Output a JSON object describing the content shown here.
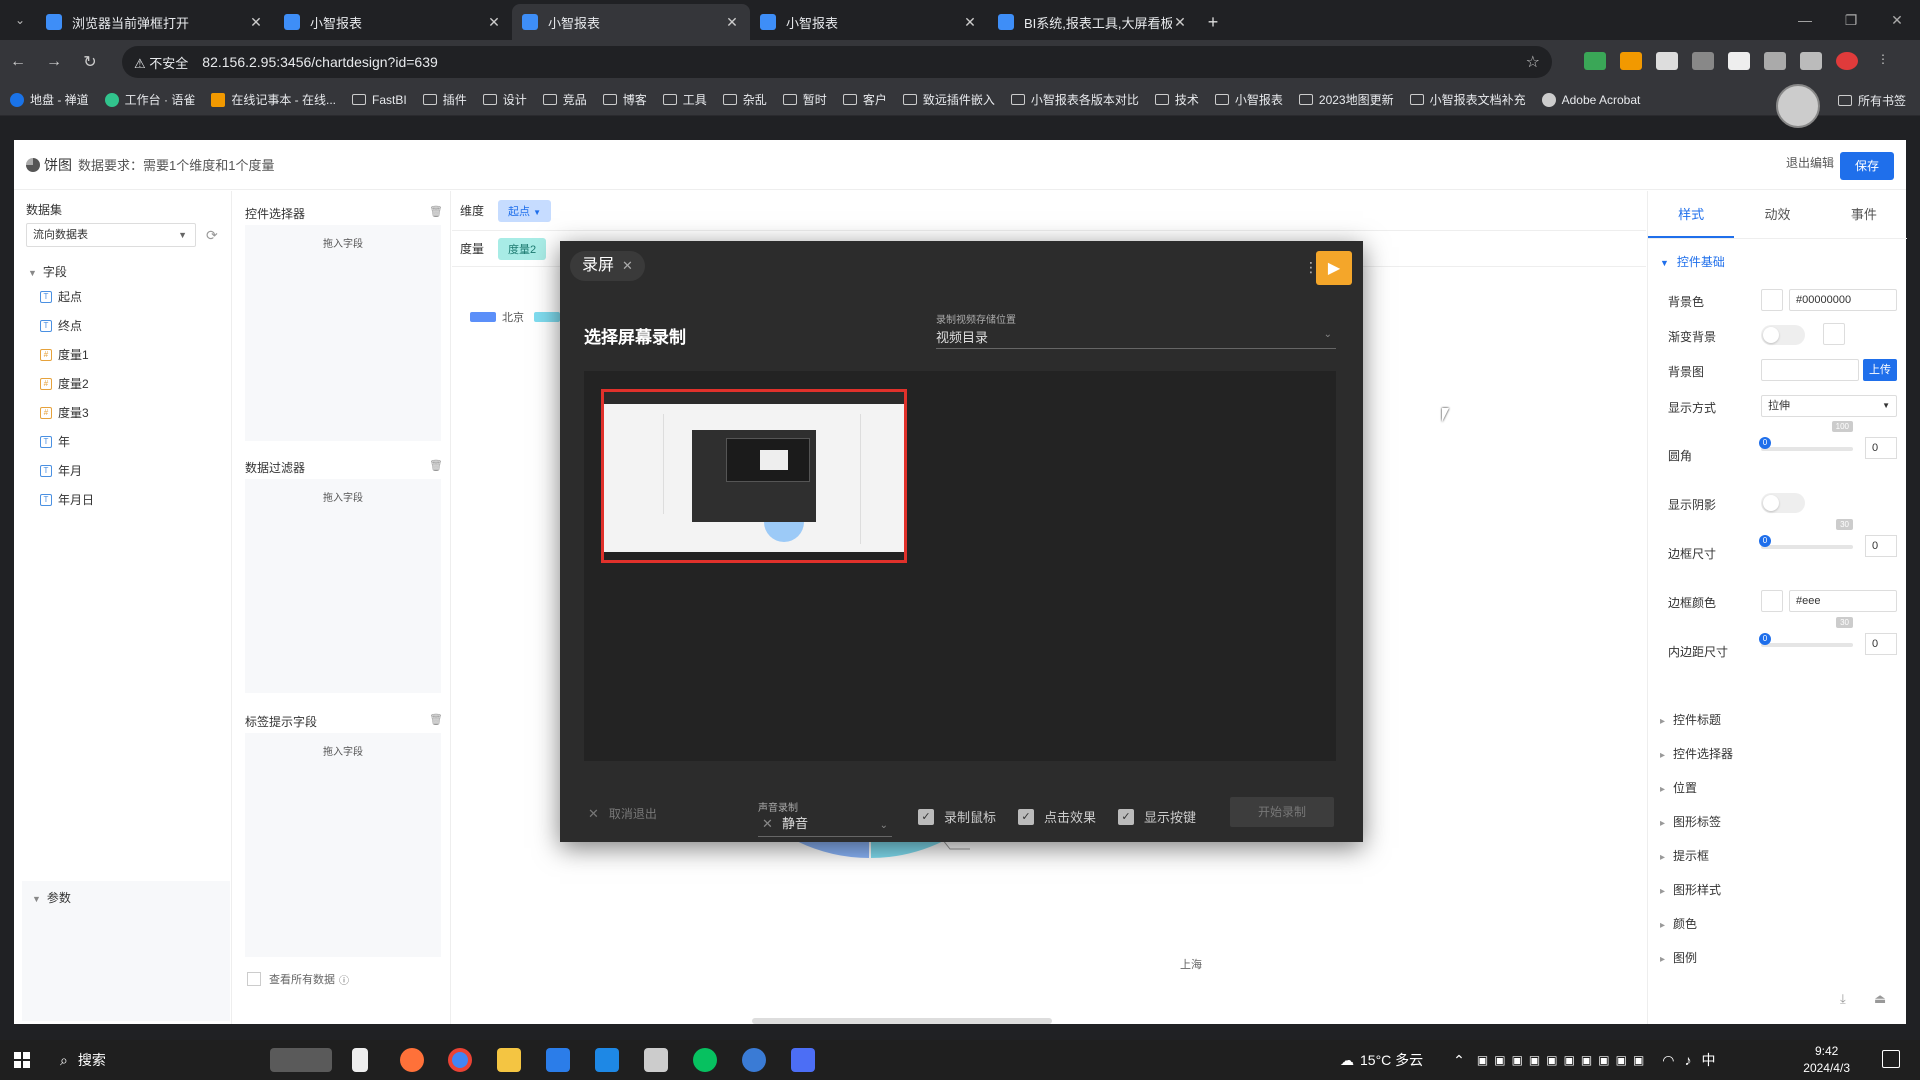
{
  "browser": {
    "tabs": [
      {
        "title": "浏览器当前弹框打开",
        "active": false
      },
      {
        "title": "小智报表",
        "active": false
      },
      {
        "title": "小智报表",
        "active": true
      },
      {
        "title": "小智报表",
        "active": false
      },
      {
        "title": "BI系统,报表工具,大屏看板,Fastl",
        "active": false
      }
    ],
    "new_tab": "+",
    "security_label": "不安全",
    "url": "82.156.2.95:3456/chartdesign?id=639",
    "bookmarks": [
      "地盘 - 禅道",
      "工作台 · 语雀",
      "在线记事本 - 在线...",
      "FastBI",
      "插件",
      "设计",
      "竞品",
      "博客",
      "工具",
      "杂乱",
      "暂时",
      "客户",
      "致远插件嵌入",
      "小智报表各版本对比",
      "技术",
      "小智报表",
      "2023地图更新",
      "小智报表文档补充",
      "Adobe Acrobat"
    ],
    "all_bookmarks": "所有书签"
  },
  "app": {
    "chart_type": "饼图",
    "data_requirement": "数据要求：需要1个维度和1个度量",
    "exit_edit": "退出编辑",
    "save": "保存",
    "dataset_title": "数据集",
    "dataset_value": "流向数据表",
    "fields_root": "字段",
    "fields": [
      {
        "name": "起点",
        "kind": "dim"
      },
      {
        "name": "终点",
        "kind": "dim"
      },
      {
        "name": "度量1",
        "kind": "measure"
      },
      {
        "name": "度量2",
        "kind": "measure"
      },
      {
        "name": "度量3",
        "kind": "measure"
      },
      {
        "name": "年",
        "kind": "dim"
      },
      {
        "name": "年月",
        "kind": "dim"
      },
      {
        "name": "年月日",
        "kind": "dim"
      }
    ],
    "params_title": "参数",
    "control_selector": "控件选择器",
    "data_filter": "数据过滤器",
    "label_tip_field": "标签提示字段",
    "drop_hint": "拖入字段",
    "show_all_data": "查看所有数据",
    "dimension_label": "维度",
    "dimension_chip": "起点",
    "measure_label": "度量",
    "measure_chip": "度量2",
    "legend": [
      {
        "name": "北京",
        "color": "#5b8ff9"
      }
    ],
    "pie_label_shanghai": "上海"
  },
  "props": {
    "tabs": [
      "样式",
      "动效",
      "事件"
    ],
    "section_basic": "控件基础",
    "bg_color_label": "背景色",
    "bg_color_value": "#00000000",
    "gradient_label": "渐变背景",
    "bg_image_label": "背景图",
    "upload": "上传",
    "display_mode_label": "显示方式",
    "display_mode_value": "拉伸",
    "radius_label": "圆角",
    "radius_min": "0",
    "radius_max": "100",
    "radius_value": "0",
    "shadow_label": "显示阴影",
    "border_size_label": "边框尺寸",
    "border_min": "0",
    "border_max": "30",
    "border_value": "0",
    "border_color_label": "边框颜色",
    "border_color_value": "#eee",
    "padding_label": "内边距尺寸",
    "padding_min": "0",
    "padding_max": "30",
    "padding_value": "0",
    "collapsed": [
      "控件标题",
      "控件选择器",
      "位置",
      "图形标签",
      "提示框",
      "图形样式",
      "颜色",
      "图例"
    ]
  },
  "recorder": {
    "tab_label": "录屏",
    "title": "选择屏幕录制",
    "save_location_label": "录制视频存储位置",
    "save_location_value": "视频目录",
    "cancel": "取消退出",
    "audio_label": "声音录制",
    "audio_value": "静音",
    "opt_mouse": "录制鼠标",
    "opt_click": "点击效果",
    "opt_keys": "显示按键",
    "start": "开始录制"
  },
  "taskbar": {
    "search": "搜索",
    "weather": "15°C 多云",
    "ime": "中",
    "time": "9:42",
    "date": "2024/4/3"
  },
  "chart_data": {
    "type": "pie",
    "categories": [
      "北京",
      "上海"
    ],
    "colors": [
      "#8ab4f8",
      "#7fdcef"
    ]
  }
}
